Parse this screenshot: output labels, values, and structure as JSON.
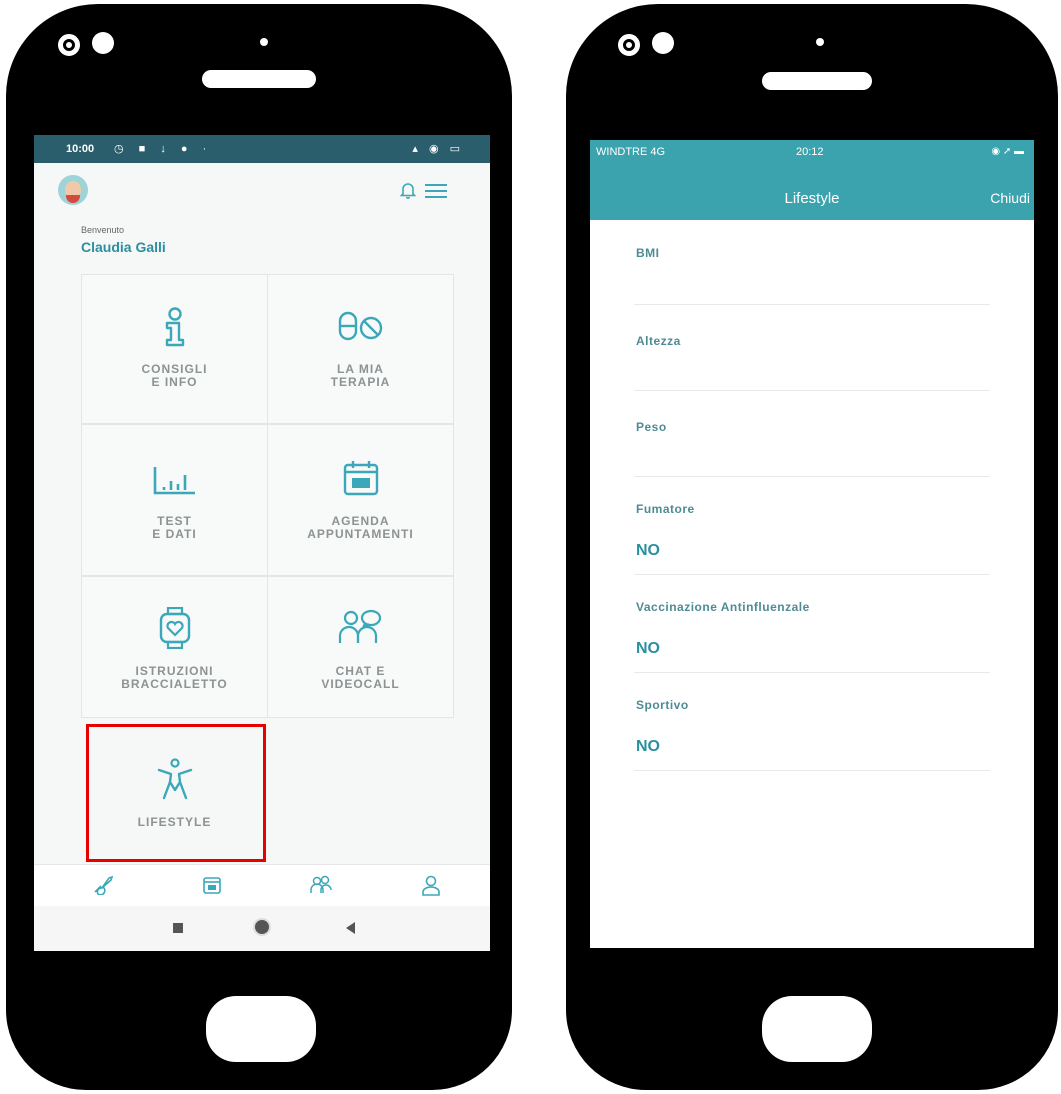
{
  "left_phone": {
    "status_bar": {
      "time": "10:00",
      "icons": "◷ ■ ↓ ● ·",
      "right_icons": "▴ ◉ ▭"
    },
    "header": {
      "welcome": "Benvenuto",
      "user_name": "Claudia Galli"
    },
    "tiles": [
      {
        "line1": "CONSIGLI",
        "line2": "E INFO",
        "icon": "info-icon"
      },
      {
        "line1": "LA MIA",
        "line2": "TERAPIA",
        "icon": "pill-icon"
      },
      {
        "line1": "TEST",
        "line2": "E DATI",
        "icon": "bar-chart-icon"
      },
      {
        "line1": "AGENDA",
        "line2": "APPUNTAMENTI",
        "icon": "calendar-icon"
      },
      {
        "line1": "ISTRUZIONI",
        "line2": "BRACCIALETTO",
        "icon": "smartwatch-icon"
      },
      {
        "line1": "CHAT E",
        "line2": "VIDEOCALL",
        "icon": "chat-people-icon"
      },
      {
        "line1": "LIFESTYLE",
        "line2": "",
        "icon": "person-icon"
      }
    ],
    "tab_bar": [
      "rocket-icon",
      "calendar-icon",
      "people-icon",
      "profile-icon"
    ],
    "accent_color": "#3aa8b8",
    "highlight_color": "#e60000"
  },
  "right_phone": {
    "status_bar": {
      "carrier": "WINDTRE 4G",
      "time": "20:12",
      "right_icons": "◉ ➚ ▬"
    },
    "header": {
      "title": "Lifestyle",
      "close_label": "Chiudi"
    },
    "fields": [
      {
        "label": "BMI",
        "value": ""
      },
      {
        "label": "Altezza",
        "value": ""
      },
      {
        "label": "Peso",
        "value": ""
      },
      {
        "label": "Fumatore",
        "value": "NO"
      },
      {
        "label": "Vaccinazione Antinfluenzale",
        "value": "NO"
      },
      {
        "label": "Sportivo",
        "value": "NO"
      }
    ],
    "header_color": "#3ba3ae"
  }
}
